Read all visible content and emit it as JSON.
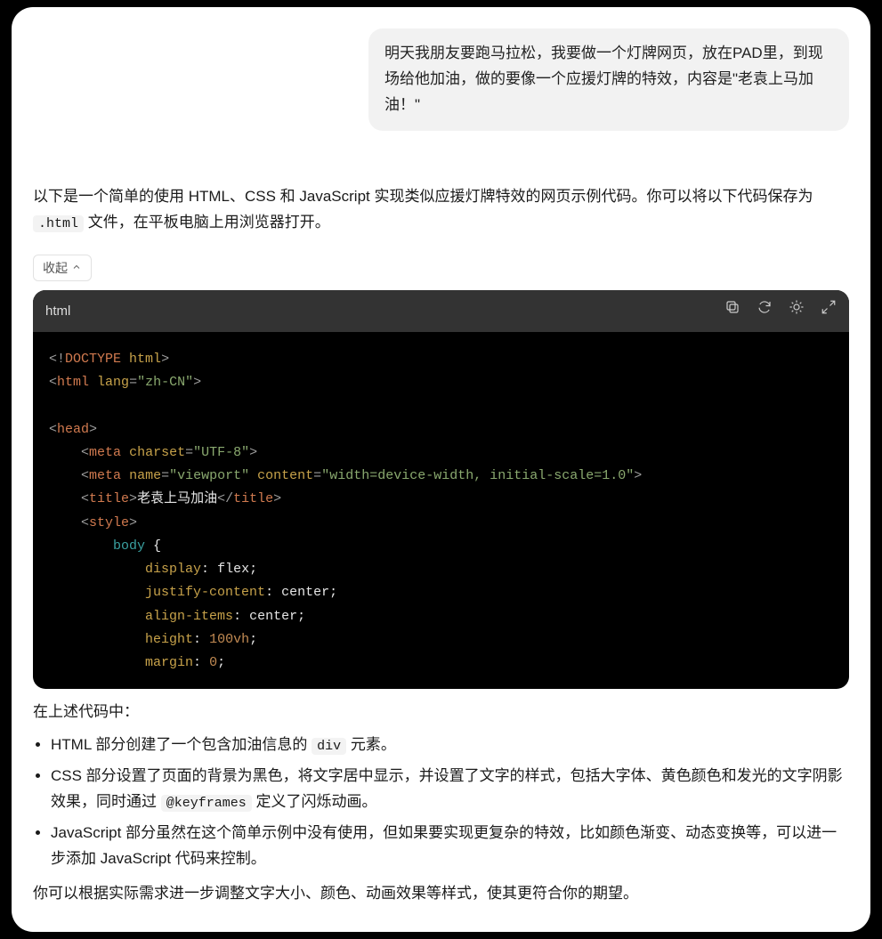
{
  "user_message": "明天我朋友要跑马拉松，我要做一个灯牌网页，放在PAD里，到现场给他加油，做的要像一个应援灯牌的特效，内容是\"老袁上马加油！\"",
  "intro": {
    "before_code": "以下是一个简单的使用 HTML、CSS 和 JavaScript 实现类似应援灯牌特效的网页示例代码。你可以将以下代码保存为 ",
    "code_inline": ".html",
    "after_code": " 文件，在平板电脑上用浏览器打开。"
  },
  "collapse_label": "收起",
  "codeblock": {
    "lang_label": "html",
    "icons": {
      "copy": "copy-icon",
      "retry": "retry-icon",
      "theme": "sun-icon",
      "expand": "expand-icon"
    },
    "content": {
      "title_text": "老袁上马加油",
      "lang_attr": "zh-CN",
      "charset": "UTF-8",
      "viewport_name": "viewport",
      "viewport_content": "width=device-width, initial-scale=1.0",
      "css": {
        "selector": "body",
        "decls": [
          {
            "prop": "display",
            "val": "flex"
          },
          {
            "prop": "justify-content",
            "val": "center"
          },
          {
            "prop": "align-items",
            "val": "center"
          },
          {
            "prop": "height",
            "val": "100vh"
          },
          {
            "prop": "margin",
            "val": "0"
          }
        ]
      }
    }
  },
  "after_code_intro": "在上述代码中：",
  "bullets": {
    "b1_pre": "HTML 部分创建了一个包含加油信息的 ",
    "b1_code": "div",
    "b1_post": " 元素。",
    "b2_pre": "CSS 部分设置了页面的背景为黑色，将文字居中显示，并设置了文字的样式，包括大字体、黄色颜色和发光的文字阴影效果，同时通过 ",
    "b2_code": "@keyframes",
    "b2_post": " 定义了闪烁动画。",
    "b3": "JavaScript 部分虽然在这个简单示例中没有使用，但如果要实现更复杂的特效，比如颜色渐变、动态变换等，可以进一步添加 JavaScript 代码来控制。"
  },
  "closing": "你可以根据实际需求进一步调整文字大小、颜色、动画效果等样式，使其更符合你的期望。"
}
